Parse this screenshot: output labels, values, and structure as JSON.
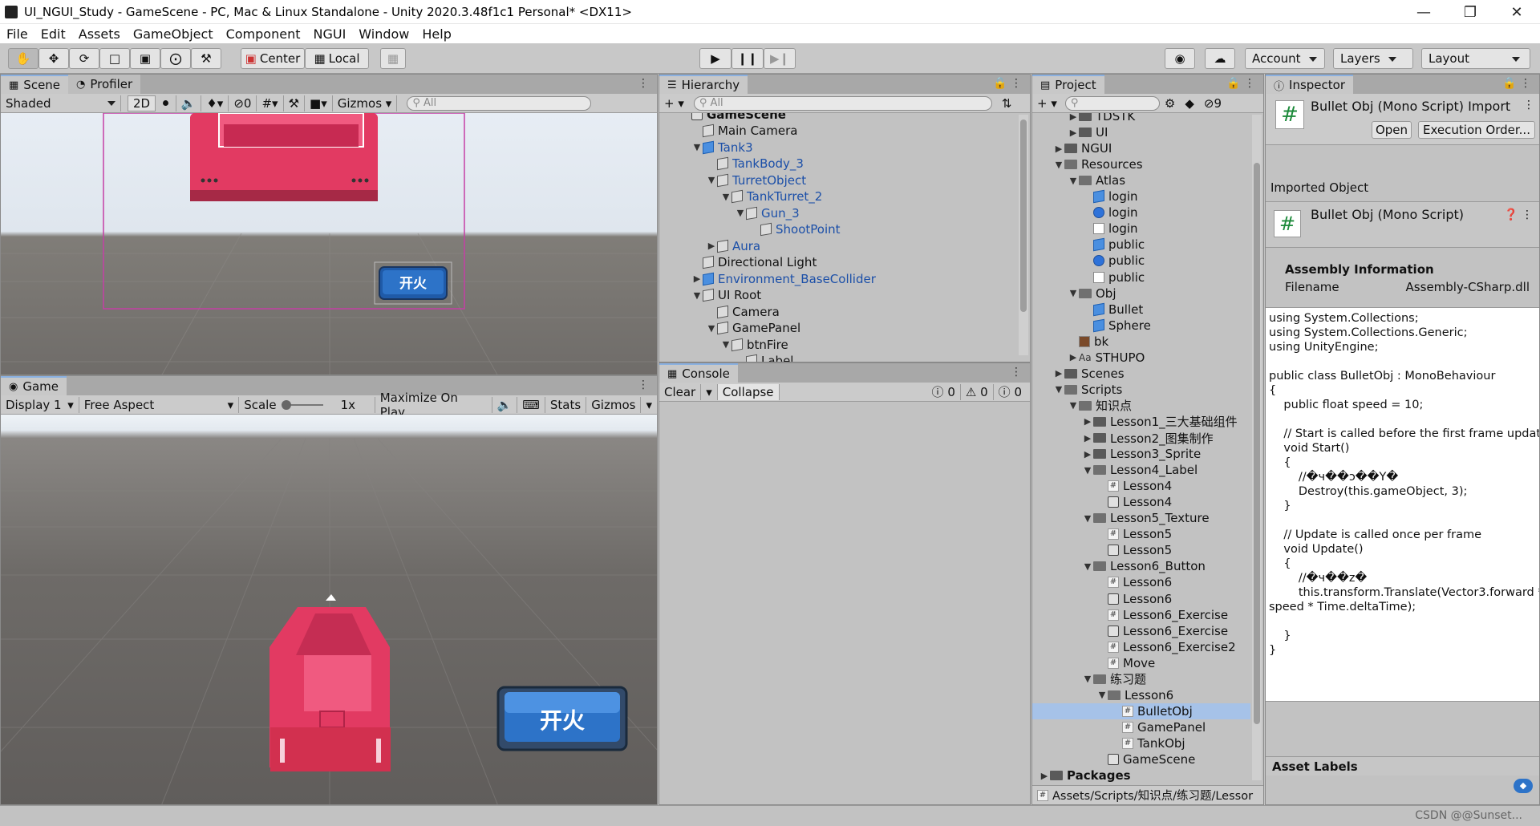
{
  "window": {
    "title": "UI_NGUI_Study - GameScene - PC, Mac & Linux Standalone - Unity 2020.3.48f1c1 Personal* <DX11>"
  },
  "menu": [
    "File",
    "Edit",
    "Assets",
    "GameObject",
    "Component",
    "NGUI",
    "Window",
    "Help"
  ],
  "toolbar": {
    "center": "Center",
    "local": "Local",
    "account": "Account",
    "layers": "Layers",
    "layout": "Layout"
  },
  "scene": {
    "tab": "Scene",
    "profiler_tab": "Profiler",
    "shading": "Shaded",
    "mode2d": "2D",
    "hidden_count": "0",
    "gizmos": "Gizmos",
    "search_placeholder": "All",
    "button_text": "开火"
  },
  "game": {
    "tab": "Game",
    "display": "Display 1",
    "aspect": "Free Aspect",
    "scale_label": "Scale",
    "scale_value": "1x",
    "maximize": "Maximize On Play",
    "stats": "Stats",
    "gizmos": "Gizmos",
    "button_text": "开火"
  },
  "hierarchy": {
    "tab": "Hierarchy",
    "search_placeholder": "All",
    "top_clipped": "GameScene",
    "items": [
      {
        "label": "Main Camera",
        "depth": 1,
        "arrow": "",
        "blue": false,
        "cube": "gray"
      },
      {
        "label": "Tank3",
        "depth": 1,
        "arrow": "open",
        "blue": true,
        "cube": "blue",
        "more": true
      },
      {
        "label": "TankBody_3",
        "depth": 2,
        "arrow": "",
        "blue": true,
        "cube": "gray"
      },
      {
        "label": "TurretObject",
        "depth": 2,
        "arrow": "open",
        "blue": true,
        "cube": "gray"
      },
      {
        "label": "TankTurret_2",
        "depth": 3,
        "arrow": "open",
        "blue": true,
        "cube": "gray"
      },
      {
        "label": "Gun_3",
        "depth": 4,
        "arrow": "open",
        "blue": true,
        "cube": "gray"
      },
      {
        "label": "ShootPoint",
        "depth": 5,
        "arrow": "",
        "blue": true,
        "cube": "gray"
      },
      {
        "label": "Aura",
        "depth": 2,
        "arrow": "closed",
        "blue": true,
        "cube": "gray"
      },
      {
        "label": "Directional Light",
        "depth": 1,
        "arrow": "",
        "blue": false,
        "cube": "gray"
      },
      {
        "label": "Environment_BaseCollider",
        "depth": 1,
        "arrow": "closed",
        "blue": true,
        "cube": "blue",
        "more": true
      },
      {
        "label": "UI Root",
        "depth": 1,
        "arrow": "open",
        "blue": false,
        "cube": "gray"
      },
      {
        "label": "Camera",
        "depth": 2,
        "arrow": "",
        "blue": false,
        "cube": "gray"
      },
      {
        "label": "GamePanel",
        "depth": 2,
        "arrow": "open",
        "blue": false,
        "cube": "gray"
      },
      {
        "label": "btnFire",
        "depth": 3,
        "arrow": "open",
        "blue": false,
        "cube": "gray"
      },
      {
        "label": "Label",
        "depth": 4,
        "arrow": "",
        "blue": false,
        "cube": "gray"
      }
    ]
  },
  "console": {
    "tab": "Console",
    "clear": "Clear",
    "collapse": "Collapse",
    "errors": "0",
    "warnings": "0",
    "messages": "0"
  },
  "project": {
    "tab": "Project",
    "hidden_count": "9",
    "path": "Assets/Scripts/知识点/练习题/Lessor",
    "items": [
      {
        "label": "TDSTK",
        "depth": 2,
        "arrow": "closed",
        "icon": "folder"
      },
      {
        "label": "UI",
        "depth": 2,
        "arrow": "closed",
        "icon": "folder"
      },
      {
        "label": "NGUI",
        "depth": 1,
        "arrow": "closed",
        "icon": "folder"
      },
      {
        "label": "Resources",
        "depth": 1,
        "arrow": "open",
        "icon": "folder-open"
      },
      {
        "label": "Atlas",
        "depth": 2,
        "arrow": "open",
        "icon": "folder-open"
      },
      {
        "label": "login",
        "depth": 3,
        "arrow": "",
        "icon": "prefab"
      },
      {
        "label": "login",
        "depth": 3,
        "arrow": "",
        "icon": "ball"
      },
      {
        "label": "login",
        "depth": 3,
        "arrow": "",
        "icon": "file"
      },
      {
        "label": "public",
        "depth": 3,
        "arrow": "",
        "icon": "prefab"
      },
      {
        "label": "public",
        "depth": 3,
        "arrow": "",
        "icon": "ball"
      },
      {
        "label": "public",
        "depth": 3,
        "arrow": "",
        "icon": "file"
      },
      {
        "label": "Obj",
        "depth": 2,
        "arrow": "open",
        "icon": "folder-open"
      },
      {
        "label": "Bullet",
        "depth": 3,
        "arrow": "",
        "icon": "cube"
      },
      {
        "label": "Sphere",
        "depth": 3,
        "arrow": "",
        "icon": "cube"
      },
      {
        "label": "bk",
        "depth": 2,
        "arrow": "",
        "icon": "image"
      },
      {
        "label": "STHUPO",
        "depth": 2,
        "arrow": "closed",
        "icon": "font"
      },
      {
        "label": "Scenes",
        "depth": 1,
        "arrow": "closed",
        "icon": "folder"
      },
      {
        "label": "Scripts",
        "depth": 1,
        "arrow": "open",
        "icon": "folder-open"
      },
      {
        "label": "知识点",
        "depth": 2,
        "arrow": "open",
        "icon": "folder-open"
      },
      {
        "label": "Lesson1_三大基础组件",
        "depth": 3,
        "arrow": "closed",
        "icon": "folder"
      },
      {
        "label": "Lesson2_图集制作",
        "depth": 3,
        "arrow": "closed",
        "icon": "folder"
      },
      {
        "label": "Lesson3_Sprite",
        "depth": 3,
        "arrow": "closed",
        "icon": "folder"
      },
      {
        "label": "Lesson4_Label",
        "depth": 3,
        "arrow": "open",
        "icon": "folder-open"
      },
      {
        "label": "Lesson4",
        "depth": 4,
        "arrow": "",
        "icon": "cs"
      },
      {
        "label": "Lesson4",
        "depth": 4,
        "arrow": "",
        "icon": "scene"
      },
      {
        "label": "Lesson5_Texture",
        "depth": 3,
        "arrow": "open",
        "icon": "folder-open"
      },
      {
        "label": "Lesson5",
        "depth": 4,
        "arrow": "",
        "icon": "cs"
      },
      {
        "label": "Lesson5",
        "depth": 4,
        "arrow": "",
        "icon": "scene"
      },
      {
        "label": "Lesson6_Button",
        "depth": 3,
        "arrow": "open",
        "icon": "folder-open"
      },
      {
        "label": "Lesson6",
        "depth": 4,
        "arrow": "",
        "icon": "cs"
      },
      {
        "label": "Lesson6",
        "depth": 4,
        "arrow": "",
        "icon": "scene"
      },
      {
        "label": "Lesson6_Exercise",
        "depth": 4,
        "arrow": "",
        "icon": "cs"
      },
      {
        "label": "Lesson6_Exercise",
        "depth": 4,
        "arrow": "",
        "icon": "scene"
      },
      {
        "label": "Lesson6_Exercise2",
        "depth": 4,
        "arrow": "",
        "icon": "cs"
      },
      {
        "label": "Move",
        "depth": 4,
        "arrow": "",
        "icon": "cs"
      },
      {
        "label": "练习题",
        "depth": 3,
        "arrow": "open",
        "icon": "folder-open"
      },
      {
        "label": "Lesson6",
        "depth": 4,
        "arrow": "open",
        "icon": "folder-open"
      },
      {
        "label": "BulletObj",
        "depth": 5,
        "arrow": "",
        "icon": "cs",
        "selected": true
      },
      {
        "label": "GamePanel",
        "depth": 5,
        "arrow": "",
        "icon": "cs"
      },
      {
        "label": "TankObj",
        "depth": 5,
        "arrow": "",
        "icon": "cs"
      },
      {
        "label": "GameScene",
        "depth": 4,
        "arrow": "",
        "icon": "scene"
      },
      {
        "label": "Packages",
        "depth": 0,
        "arrow": "closed",
        "icon": "folder",
        "bold": true
      }
    ]
  },
  "inspector": {
    "tab": "Inspector",
    "header_title": "Bullet Obj (Mono Script) Import",
    "open": "Open",
    "execution_order": "Execution Order...",
    "imported_object": "Imported Object",
    "object_title": "Bullet Obj (Mono Script)",
    "assembly_info": "Assembly Information",
    "filename_label": "Filename",
    "filename_value": "Assembly-CSharp.dll",
    "code": "using System.Collections;\nusing System.Collections.Generic;\nusing UnityEngine;\n\npublic class BulletObj : MonoBehaviour\n{\n    public float speed = 10;\n\n    // Start is called before the first frame update\n    void Start()\n    {\n        //�ч��ɔ��Y�\n        Destroy(this.gameObject, 3);\n    }\n\n    // Update is called once per frame\n    void Update()\n    {\n        //�ч��z�\n        this.transform.Translate(Vector3.forward *\nspeed * Time.deltaTime);\n\n    }\n}",
    "asset_labels": "Asset Labels"
  },
  "status": {
    "watermark": "CSDN @@Sunset..."
  },
  "colors": {
    "tank": "#e8335c",
    "button_blue": "#2d73c8",
    "selection": "#a6c2e8"
  }
}
